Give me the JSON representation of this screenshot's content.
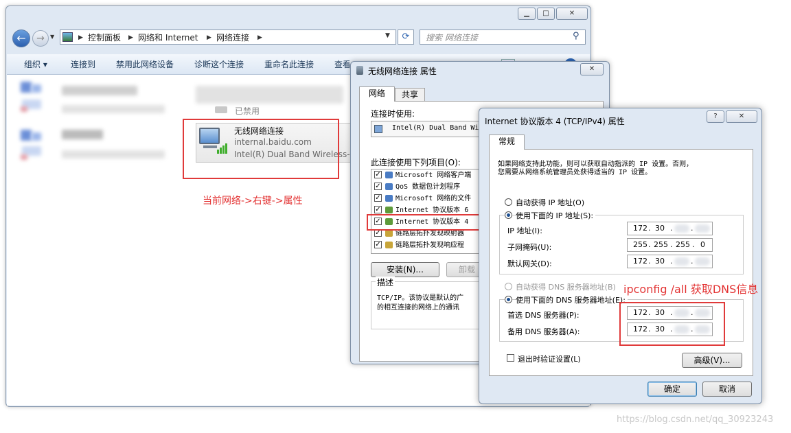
{
  "explorer": {
    "breadcrumb": [
      "控制面板",
      "网络和 Internet",
      "网络连接"
    ],
    "search_placeholder": "搜索 网络连接",
    "toolbar": [
      "组织 ▾",
      "连接到",
      "禁用此网络设备",
      "诊断这个连接",
      "重命名此连接",
      "查看此连接的状态"
    ],
    "partial_status": "已禁用",
    "adapter": {
      "name": "无线网络连接",
      "network": "internal.baidu.com",
      "device": "Intel(R) Dual Band Wireless-N"
    },
    "annotation": "当前网络->右键->属性"
  },
  "wireless_props": {
    "title": "无线网络连接 属性",
    "tabs": [
      "网络",
      "共享"
    ],
    "connect_using_label": "连接时使用:",
    "adapter": "Intel(R) Dual Band Wi",
    "items_label": "此连接使用下列项目(O):",
    "items": [
      "Microsoft 网络客户端",
      "QoS 数据包计划程序",
      "Microsoft 网络的文件",
      "Internet 协议版本 6",
      "Internet 协议版本 4",
      "链路层拓扑发现映射器",
      "链路层拓扑发现响应程"
    ],
    "install_btn": "安装(N)...",
    "uninstall_btn": "卸载",
    "desc_title": "描述",
    "desc_text": [
      "TCP/IP。该协议是默认的广",
      "的相互连接的网络上的通讯"
    ]
  },
  "ipv4": {
    "title": "Internet 协议版本 4 (TCP/IPv4) 属性",
    "tab": "常规",
    "intro": [
      "如果网络支持此功能，则可以获取自动指派的 IP 设置。否则，",
      "您需要从网络系统管理员处获得适当的 IP 设置。"
    ],
    "auto_ip": "自动获得 IP 地址(O)",
    "manual_ip": "使用下面的 IP 地址(S):",
    "ip_label": "IP 地址(I):",
    "mask_label": "子网掩码(U):",
    "gw_label": "默认网关(D):",
    "ip_value": [
      "172",
      "30"
    ],
    "mask_value": [
      "255",
      "255",
      "255",
      "0"
    ],
    "gw_value": [
      "172",
      "30"
    ],
    "auto_dns": "自动获得 DNS 服务器地址(B)",
    "manual_dns": "使用下面的 DNS 服务器地址(E):",
    "pref_dns_label": "首选 DNS 服务器(P):",
    "alt_dns_label": "备用 DNS 服务器(A):",
    "pref_dns_value": [
      "172",
      "30"
    ],
    "alt_dns_value": [
      "172",
      "30"
    ],
    "validate": "退出时验证设置(L)",
    "advanced": "高级(V)...",
    "ok": "确定",
    "cancel": "取消",
    "annotation": "ipconfig /all 获取DNS信息"
  },
  "watermark": "https://blog.csdn.net/qq_30923243"
}
